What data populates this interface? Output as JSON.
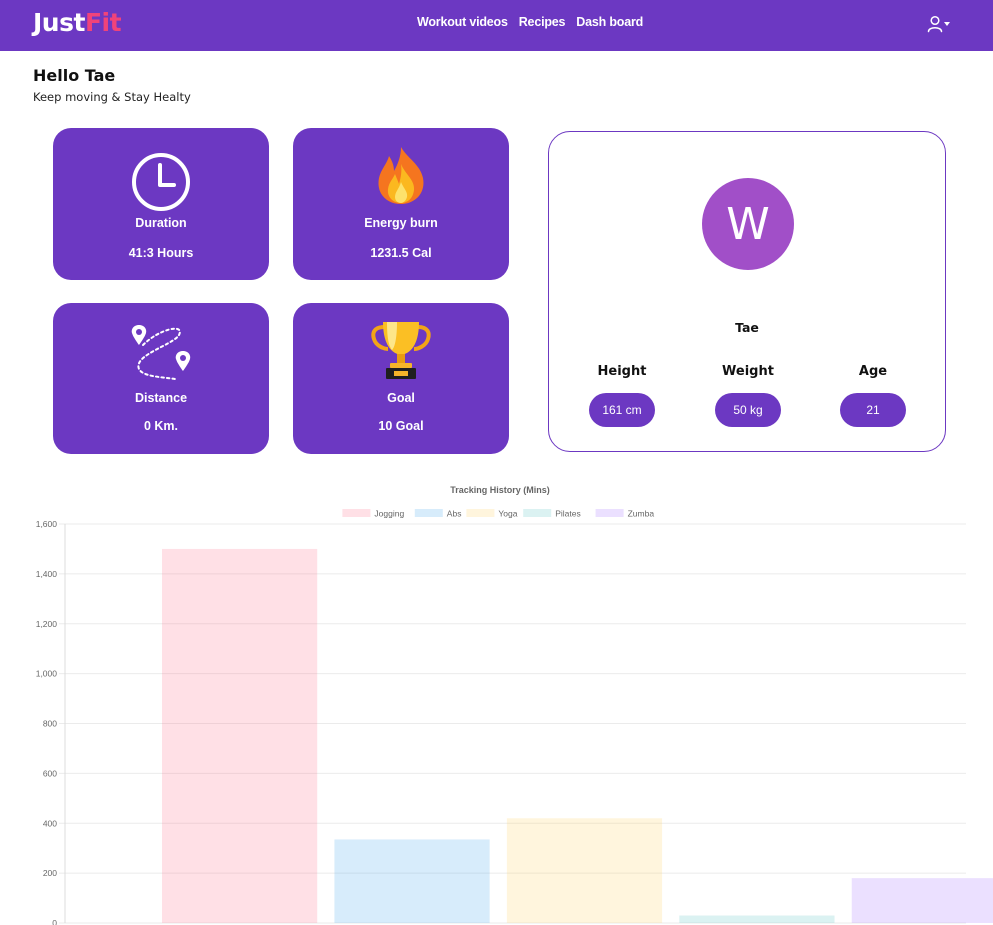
{
  "nav": {
    "brand_part1": "Just",
    "brand_part2": "Fit",
    "links": [
      "Workout videos",
      "Recipes",
      "Dash board"
    ],
    "user_icon": "user-icon"
  },
  "greeting": {
    "title": "Hello Tae",
    "subtitle": "Keep moving & Stay Healty"
  },
  "stats": [
    {
      "label": "Duration",
      "value": "41:3 Hours",
      "icon": "clock-icon"
    },
    {
      "label": "Energy burn",
      "value": "1231.5 Cal",
      "icon": "fire-icon"
    },
    {
      "label": "Distance",
      "value": "0 Km.",
      "icon": "route-icon"
    },
    {
      "label": "Goal",
      "value": "10 Goal",
      "icon": "trophy-icon"
    }
  ],
  "profile": {
    "avatar_letter": "W",
    "name": "Tae",
    "metrics": [
      {
        "label": "Height",
        "value": "161 cm"
      },
      {
        "label": "Weight",
        "value": "50 kg"
      },
      {
        "label": "Age",
        "value": "21"
      }
    ]
  },
  "colors": {
    "brand_purple": "#6c38c2",
    "brand_pink": "#f0437a",
    "avatar_purple": "#a14fc8"
  },
  "chart_data": {
    "type": "bar",
    "title": "Tracking History (Mins)",
    "xlabel": "",
    "ylabel": "",
    "categories": [
      "Jogging",
      "Abs",
      "Yoga",
      "Pilates",
      "Zumba"
    ],
    "values": [
      1500,
      335,
      420,
      30,
      180
    ],
    "colors": [
      "rgba(255,99,132,0.2)",
      "rgba(54,162,235,0.2)",
      "rgba(255,206,86,0.2)",
      "rgba(75,192,192,0.2)",
      "rgba(153,102,255,0.2)"
    ],
    "legend": [
      "Jogging",
      "Abs",
      "Yoga",
      "Pilates",
      "Zumba"
    ],
    "legend_position": "top",
    "ylim": [
      0,
      1600
    ],
    "yticks": [
      0,
      200,
      400,
      600,
      800,
      1000,
      1200,
      1400,
      1600
    ],
    "ytick_labels": [
      "0",
      "200",
      "400",
      "600",
      "800",
      "1,000",
      "1,200",
      "1,400",
      "1,600"
    ],
    "grid": true
  }
}
